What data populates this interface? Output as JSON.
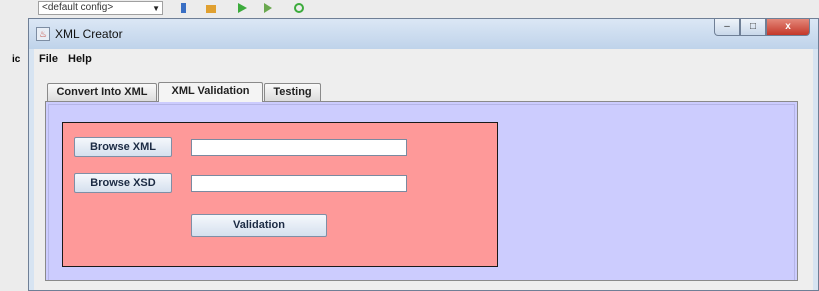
{
  "background": {
    "combo_text": "<default config>",
    "left_text": "ic"
  },
  "window": {
    "title": "XML Creator",
    "buttons": {
      "minimize": "–",
      "maximize": "□",
      "close": "x"
    }
  },
  "menubar": {
    "items": [
      "File",
      "Help"
    ]
  },
  "tabs": [
    {
      "label": "Convert Into XML",
      "active": false
    },
    {
      "label": "XML Validation",
      "active": true
    },
    {
      "label": "Testing",
      "active": false
    }
  ],
  "validation_panel": {
    "browse_xml_label": "Browse XML",
    "xml_path_value": "",
    "browse_xsd_label": "Browse XSD",
    "xsd_path_value": "",
    "validate_label": "Validation"
  },
  "colors": {
    "tab_panel_bg": "#ccccfe",
    "form_panel_bg": "#fe9999"
  }
}
